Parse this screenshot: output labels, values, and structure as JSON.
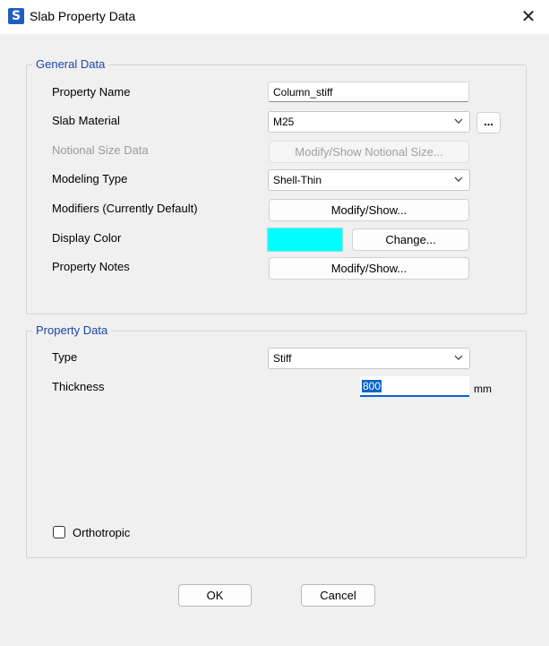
{
  "window": {
    "icon_letter": "S",
    "title": "Slab Property Data",
    "close_glyph": "✕"
  },
  "general_data": {
    "legend": "General Data",
    "property_name_label": "Property Name",
    "property_name_value": "Column_stiff",
    "slab_material_label": "Slab Material",
    "slab_material_value": "M25",
    "slab_material_more": "...",
    "notional_size_label": "Notional Size Data",
    "notional_size_button": "Modify/Show Notional Size...",
    "modeling_type_label": "Modeling Type",
    "modeling_type_value": "Shell-Thin",
    "modifiers_label": "Modifiers (Currently Default)",
    "modifiers_button": "Modify/Show...",
    "display_color_label": "Display Color",
    "display_color_value": "#00FFFF",
    "change_button": "Change...",
    "property_notes_label": "Property Notes",
    "property_notes_button": "Modify/Show..."
  },
  "property_data": {
    "legend": "Property Data",
    "type_label": "Type",
    "type_value": "Stiff",
    "thickness_label": "Thickness",
    "thickness_value": "800",
    "thickness_unit": "mm",
    "orthotropic_label": "Orthotropic",
    "orthotropic_checked": false
  },
  "footer": {
    "ok_label": "OK",
    "cancel_label": "Cancel"
  }
}
